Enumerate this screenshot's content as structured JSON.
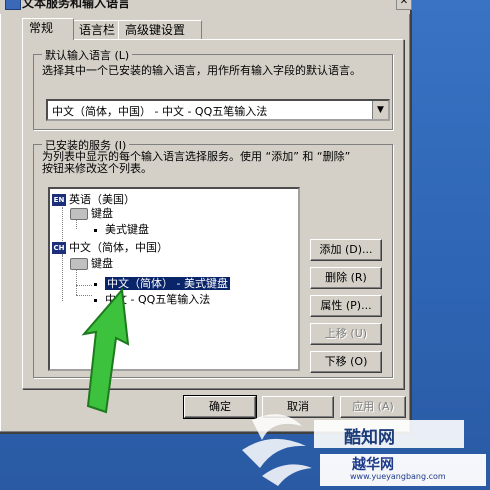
{
  "window": {
    "title": "文本服务和输入语言",
    "close_glyph": "✕"
  },
  "tabs": [
    {
      "label": "常规",
      "active": true
    },
    {
      "label": "语言栏",
      "active": false
    },
    {
      "label": "高级键设置",
      "active": false
    }
  ],
  "default_language": {
    "group_title": "默认输入语言 (L)",
    "description": "选择其中一个已安装的输入语言，用作所有输入字段的默认语言。",
    "selected_value": "中文（简体，中国） - 中文 - QQ五笔输入法"
  },
  "installed_services": {
    "group_title": "已安装的服务 (I)",
    "description_line1": "为列表中显示的每个输入语言选择服务。使用 “添加” 和 “删除”",
    "description_line2": "按钮来修改这个列表。",
    "tree": [
      {
        "badge": "EN",
        "label": "英语（美国）"
      },
      {
        "label": "键盘"
      },
      {
        "label": "美式键盘"
      },
      {
        "badge": "CH",
        "label": "中文（简体，中国）"
      },
      {
        "label": "键盘"
      },
      {
        "label": "中文（简体） - 美式键盘",
        "selected": true
      },
      {
        "label": "中文 - QQ五笔输入法"
      }
    ],
    "buttons": {
      "add": "添加 (D)...",
      "remove": "删除 (R)",
      "properties": "属性 (P)...",
      "move_up": "上移 (U)",
      "move_down": "下移 (O)"
    }
  },
  "footer": {
    "ok": "确定",
    "cancel": "取消",
    "apply": "应用 (A)"
  },
  "watermarks": {
    "site1": "酷知网",
    "site2_title": "越华网",
    "site2_url": "www.yueyangbang.com"
  },
  "colors": {
    "selection": "#0a246a",
    "arrow": "#3cc23c",
    "desktop": "#2d64b3"
  }
}
